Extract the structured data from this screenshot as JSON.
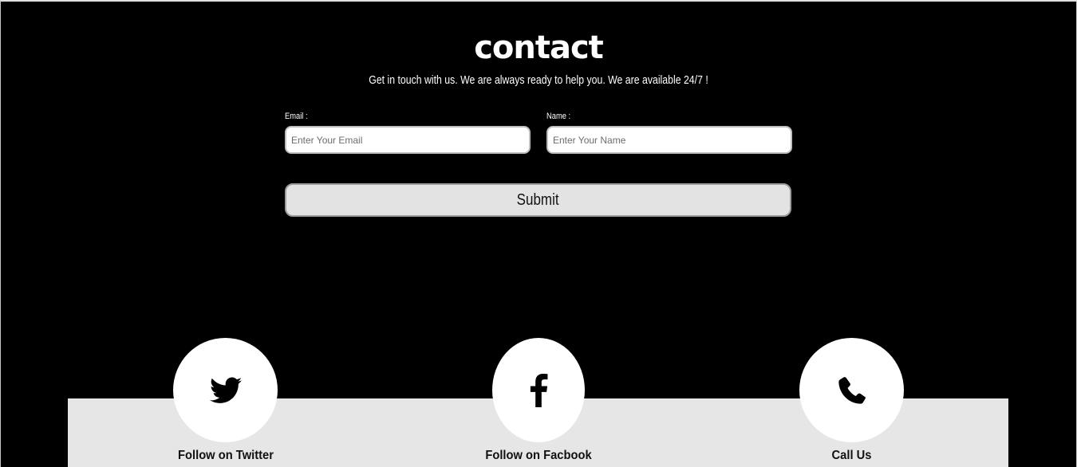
{
  "contact": {
    "title": "contact",
    "subtitle": "Get in touch with us. We are always ready to help you. We are available 24/7 !",
    "email_label": "Email :",
    "email_placeholder": "Enter Your Email",
    "email_value": "",
    "name_label": "Name :",
    "name_placeholder": "Enter Your Name",
    "name_value": "",
    "submit_label": "Submit"
  },
  "social": [
    {
      "icon": "twitter-icon",
      "label": "Follow on Twitter"
    },
    {
      "icon": "facebook-icon",
      "label": "Follow on Facbook"
    },
    {
      "icon": "phone-icon",
      "label": "Call Us"
    }
  ],
  "colors": {
    "background": "#000000",
    "band": "#e6e6e6",
    "button": "#e3e3e3",
    "text_light": "#ffffff",
    "text_dark": "#111111"
  }
}
